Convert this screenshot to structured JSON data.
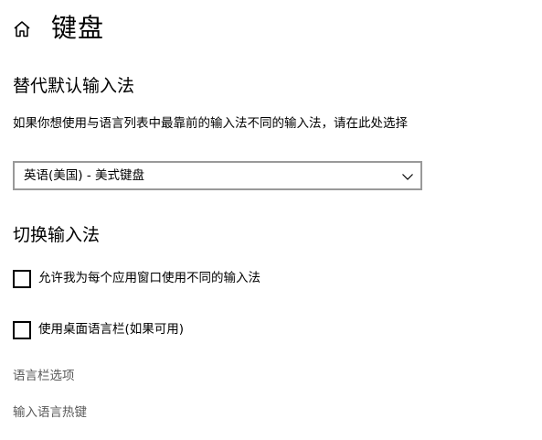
{
  "header": {
    "home_icon": "home-icon",
    "title": "键盘"
  },
  "default_input": {
    "heading": "替代默认输入法",
    "description": "如果你想使用与语言列表中最靠前的输入法不同的输入法，请在此处选择",
    "selected_value": "英语(美国) - 美式键盘",
    "chevron_icon": "chevron-down-icon"
  },
  "switch_input": {
    "heading": "切换输入法",
    "checkboxes": [
      {
        "label": "允许我为每个应用窗口使用不同的输入法",
        "checked": false
      },
      {
        "label": "使用桌面语言栏(如果可用)",
        "checked": false
      }
    ]
  },
  "links": {
    "language_bar_options": "语言栏选项",
    "input_language_hotkeys": "输入语言热键"
  },
  "colors": {
    "link": "#5a5a5a",
    "border": "#999999",
    "text": "#000000",
    "background": "#ffffff"
  }
}
